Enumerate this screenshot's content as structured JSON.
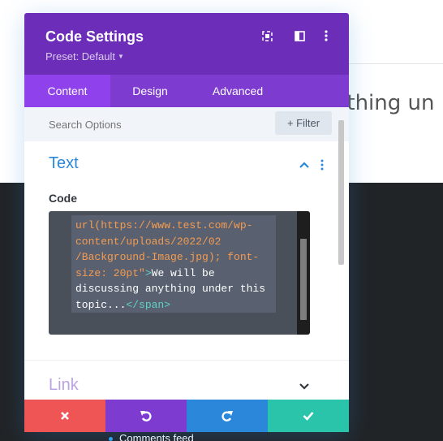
{
  "background": {
    "heading_fragment": "ything un",
    "list_item": "Comments feed"
  },
  "modal": {
    "title": "Code Settings",
    "preset": "Preset: Default",
    "header_icons": [
      "expand-icon",
      "sidebar-icon",
      "more-icon"
    ],
    "tabs": [
      {
        "label": "Content",
        "active": true
      },
      {
        "label": "Design",
        "active": false
      },
      {
        "label": "Advanced",
        "active": false
      }
    ],
    "search_placeholder": "Search Options",
    "filter_label": "+ Filter"
  },
  "content": {
    "section_title": "Text",
    "field_label": "Code",
    "code": {
      "line1": "url(https://www.test.com/wp-",
      "line2": "content/uploads/2022/02",
      "line3": "/Background-Image.jpg); font-",
      "line4_str": "size: 20pt\"",
      "line4_tag": ">",
      "line4_text": "We will be",
      "line5": "discussing anything under this",
      "line6_text": "topic...",
      "line6_tag": "</span>"
    },
    "link_section_title": "Link"
  },
  "footer_actions": [
    "close",
    "undo",
    "redo",
    "save"
  ],
  "colors": {
    "header": "#6c2eb9",
    "tab_bar": "#7d3bcf",
    "tab_active": "#8f42ec",
    "accent_blue": "#2b87da",
    "cancel": "#ef5555",
    "undo": "#7e3bd0",
    "redo": "#2b87da",
    "save": "#29c4a9"
  }
}
